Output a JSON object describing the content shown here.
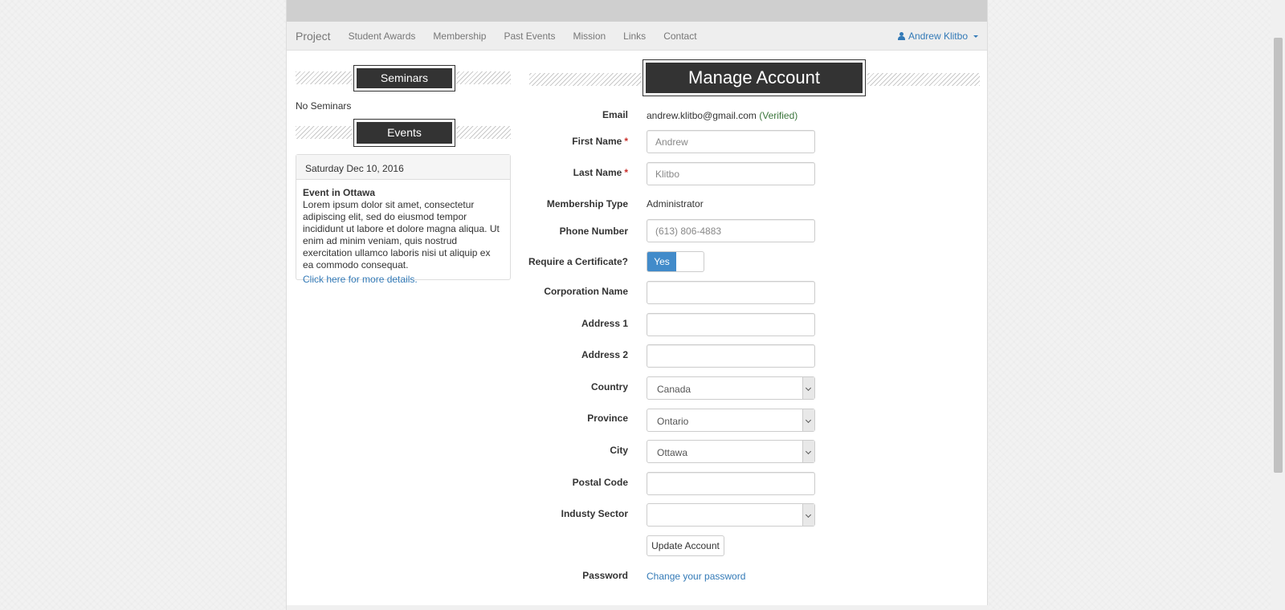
{
  "nav": {
    "brand": "Project",
    "items": [
      "Student Awards",
      "Membership",
      "Past Events",
      "Mission",
      "Links",
      "Contact"
    ],
    "user": "Andrew Klitbo"
  },
  "sidebar": {
    "seminars_title": "Seminars",
    "no_seminars": "No Seminars",
    "events_title": "Events",
    "event": {
      "date": "Saturday Dec 10, 2016",
      "title": "Event in Ottawa",
      "description": "Lorem ipsum dolor sit amet, consectetur adipiscing elit, sed do eiusmod tempor incididunt ut labore et dolore magna aliqua. Ut enim ad minim veniam, quis nostrud exercitation ullamco laboris nisi ut aliquip ex ea commodo consequat.",
      "link": "Click here for more details."
    }
  },
  "main": {
    "title": "Manage Account",
    "form": {
      "email_label": "Email",
      "email_value": "andrew.klitbo@gmail.com",
      "email_status": "(Verified)",
      "first_name_label": "First Name",
      "first_name_placeholder": "Andrew",
      "last_name_label": "Last Name",
      "last_name_placeholder": "Klitbo",
      "required_mark": "*",
      "membership_label": "Membership Type",
      "membership_value": "Administrator",
      "phone_label": "Phone Number",
      "phone_placeholder": "(613) 806-4883",
      "certificate_label": "Require a Certificate?",
      "certificate_toggle": "Yes",
      "corporation_label": "Corporation Name",
      "corporation_value": "",
      "address1_label": "Address 1",
      "address1_value": "",
      "address2_label": "Address 2",
      "address2_value": "",
      "country_label": "Country",
      "country_value": "Canada",
      "province_label": "Province",
      "province_value": "Ontario",
      "city_label": "City",
      "city_value": "Ottawa",
      "postal_label": "Postal Code",
      "postal_value": "",
      "industry_label": "Industy Sector",
      "industry_value": "",
      "update_button": "Update Account",
      "password_label": "Password",
      "password_link": "Change your password"
    }
  }
}
